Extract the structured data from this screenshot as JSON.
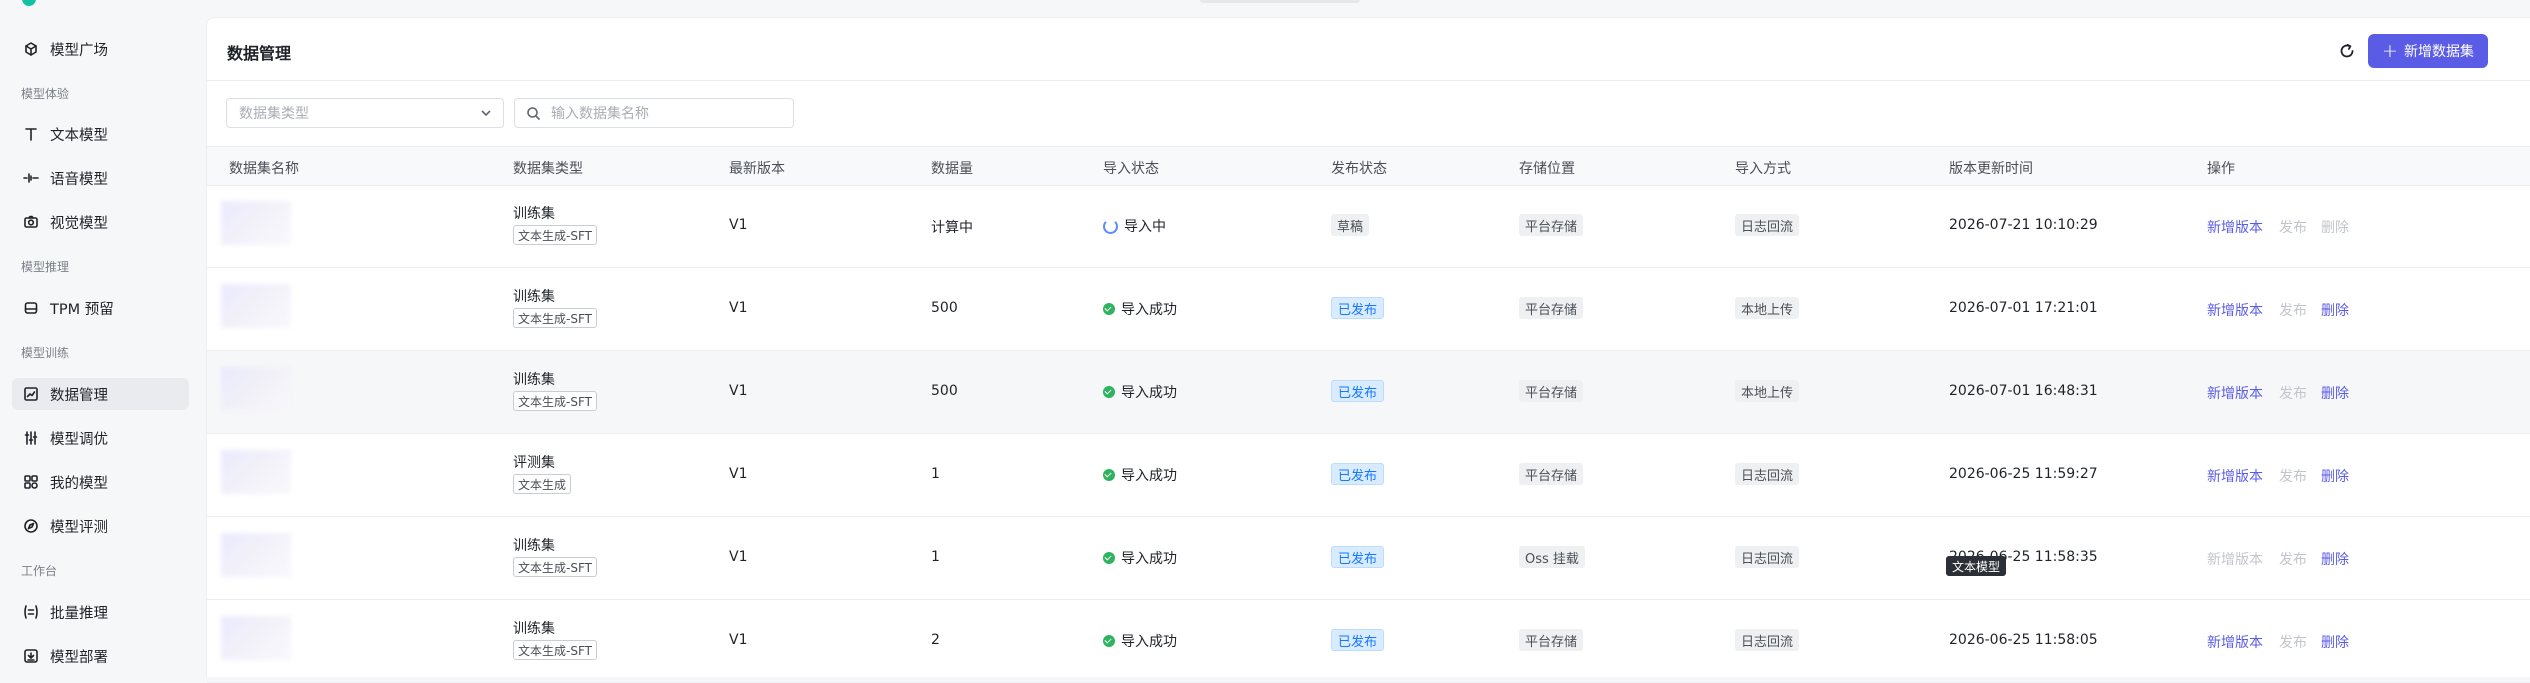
{
  "sidebar": {
    "items": [
      {
        "label": "模型广场",
        "icon": "model-square-icon"
      },
      {
        "label": "文本模型",
        "icon": "text-icon"
      },
      {
        "label": "语音模型",
        "icon": "voice-icon"
      },
      {
        "label": "视觉模型",
        "icon": "camera-icon"
      },
      {
        "label": "TPM 预留",
        "icon": "database-icon"
      },
      {
        "label": "数据管理",
        "icon": "chart-icon"
      },
      {
        "label": "模型调优",
        "icon": "sliders-icon"
      },
      {
        "label": "我的模型",
        "icon": "apps-icon"
      },
      {
        "label": "模型评测",
        "icon": "compass-icon"
      },
      {
        "label": "批量推理",
        "icon": "list-icon"
      },
      {
        "label": "模型部署",
        "icon": "deploy-icon"
      }
    ],
    "sections": [
      "模型体验",
      "模型推理",
      "模型训练",
      "工作台"
    ]
  },
  "header": {
    "title": "数据管理",
    "add_button": "新增数据集"
  },
  "filters": {
    "type_placeholder": "数据集类型",
    "search_placeholder": "输入数据集名称"
  },
  "table": {
    "columns": [
      "数据集名称",
      "数据集类型",
      "最新版本",
      "数据量",
      "导入状态",
      "发布状态",
      "存储位置",
      "导入方式",
      "版本更新时间",
      "操作"
    ],
    "rows": [
      {
        "type": "训练集",
        "tag": "文本生成-SFT",
        "version": "V1",
        "count": "计算中",
        "import_status": "导入中",
        "publish": "草稿",
        "storage": "平台存储",
        "method": "日志回流",
        "updated": "2026-07-21 10:10:29",
        "op_add": "新增版本",
        "op_publish": "发布",
        "op_delete": "删除"
      },
      {
        "type": "训练集",
        "tag": "文本生成-SFT",
        "version": "V1",
        "count": "500",
        "import_status": "导入成功",
        "publish": "已发布",
        "storage": "平台存储",
        "method": "本地上传",
        "updated": "2026-07-01 17:21:01",
        "op_add": "新增版本",
        "op_publish": "发布",
        "op_delete": "删除"
      },
      {
        "type": "训练集",
        "tag": "文本生成-SFT",
        "version": "V1",
        "count": "500",
        "import_status": "导入成功",
        "publish": "已发布",
        "storage": "平台存储",
        "method": "本地上传",
        "updated": "2026-07-01 16:48:31",
        "op_add": "新增版本",
        "op_publish": "发布",
        "op_delete": "删除"
      },
      {
        "type": "评测集",
        "tag": "文本生成",
        "version": "V1",
        "count": "1",
        "import_status": "导入成功",
        "publish": "已发布",
        "storage": "平台存储",
        "method": "日志回流",
        "updated": "2026-06-25 11:59:27",
        "op_add": "新增版本",
        "op_publish": "发布",
        "op_delete": "删除"
      },
      {
        "type": "训练集",
        "tag": "文本生成-SFT",
        "version": "V1",
        "count": "1",
        "import_status": "导入成功",
        "publish": "已发布",
        "storage": "Oss 挂载",
        "method": "日志回流",
        "updated": "2026-06-25 11:58:35",
        "op_add": "新增版本",
        "op_publish": "发布",
        "op_delete": "删除"
      },
      {
        "type": "训练集",
        "tag": "文本生成-SFT",
        "version": "V1",
        "count": "2",
        "import_status": "导入成功",
        "publish": "已发布",
        "storage": "平台存储",
        "method": "日志回流",
        "updated": "2026-06-25 11:58:05",
        "op_add": "新增版本",
        "op_publish": "发布",
        "op_delete": "删除"
      }
    ]
  },
  "tooltip": "文本模型",
  "colors": {
    "accent": "#5b5ce6",
    "success": "#2fb35f",
    "published": "#1677ff"
  }
}
